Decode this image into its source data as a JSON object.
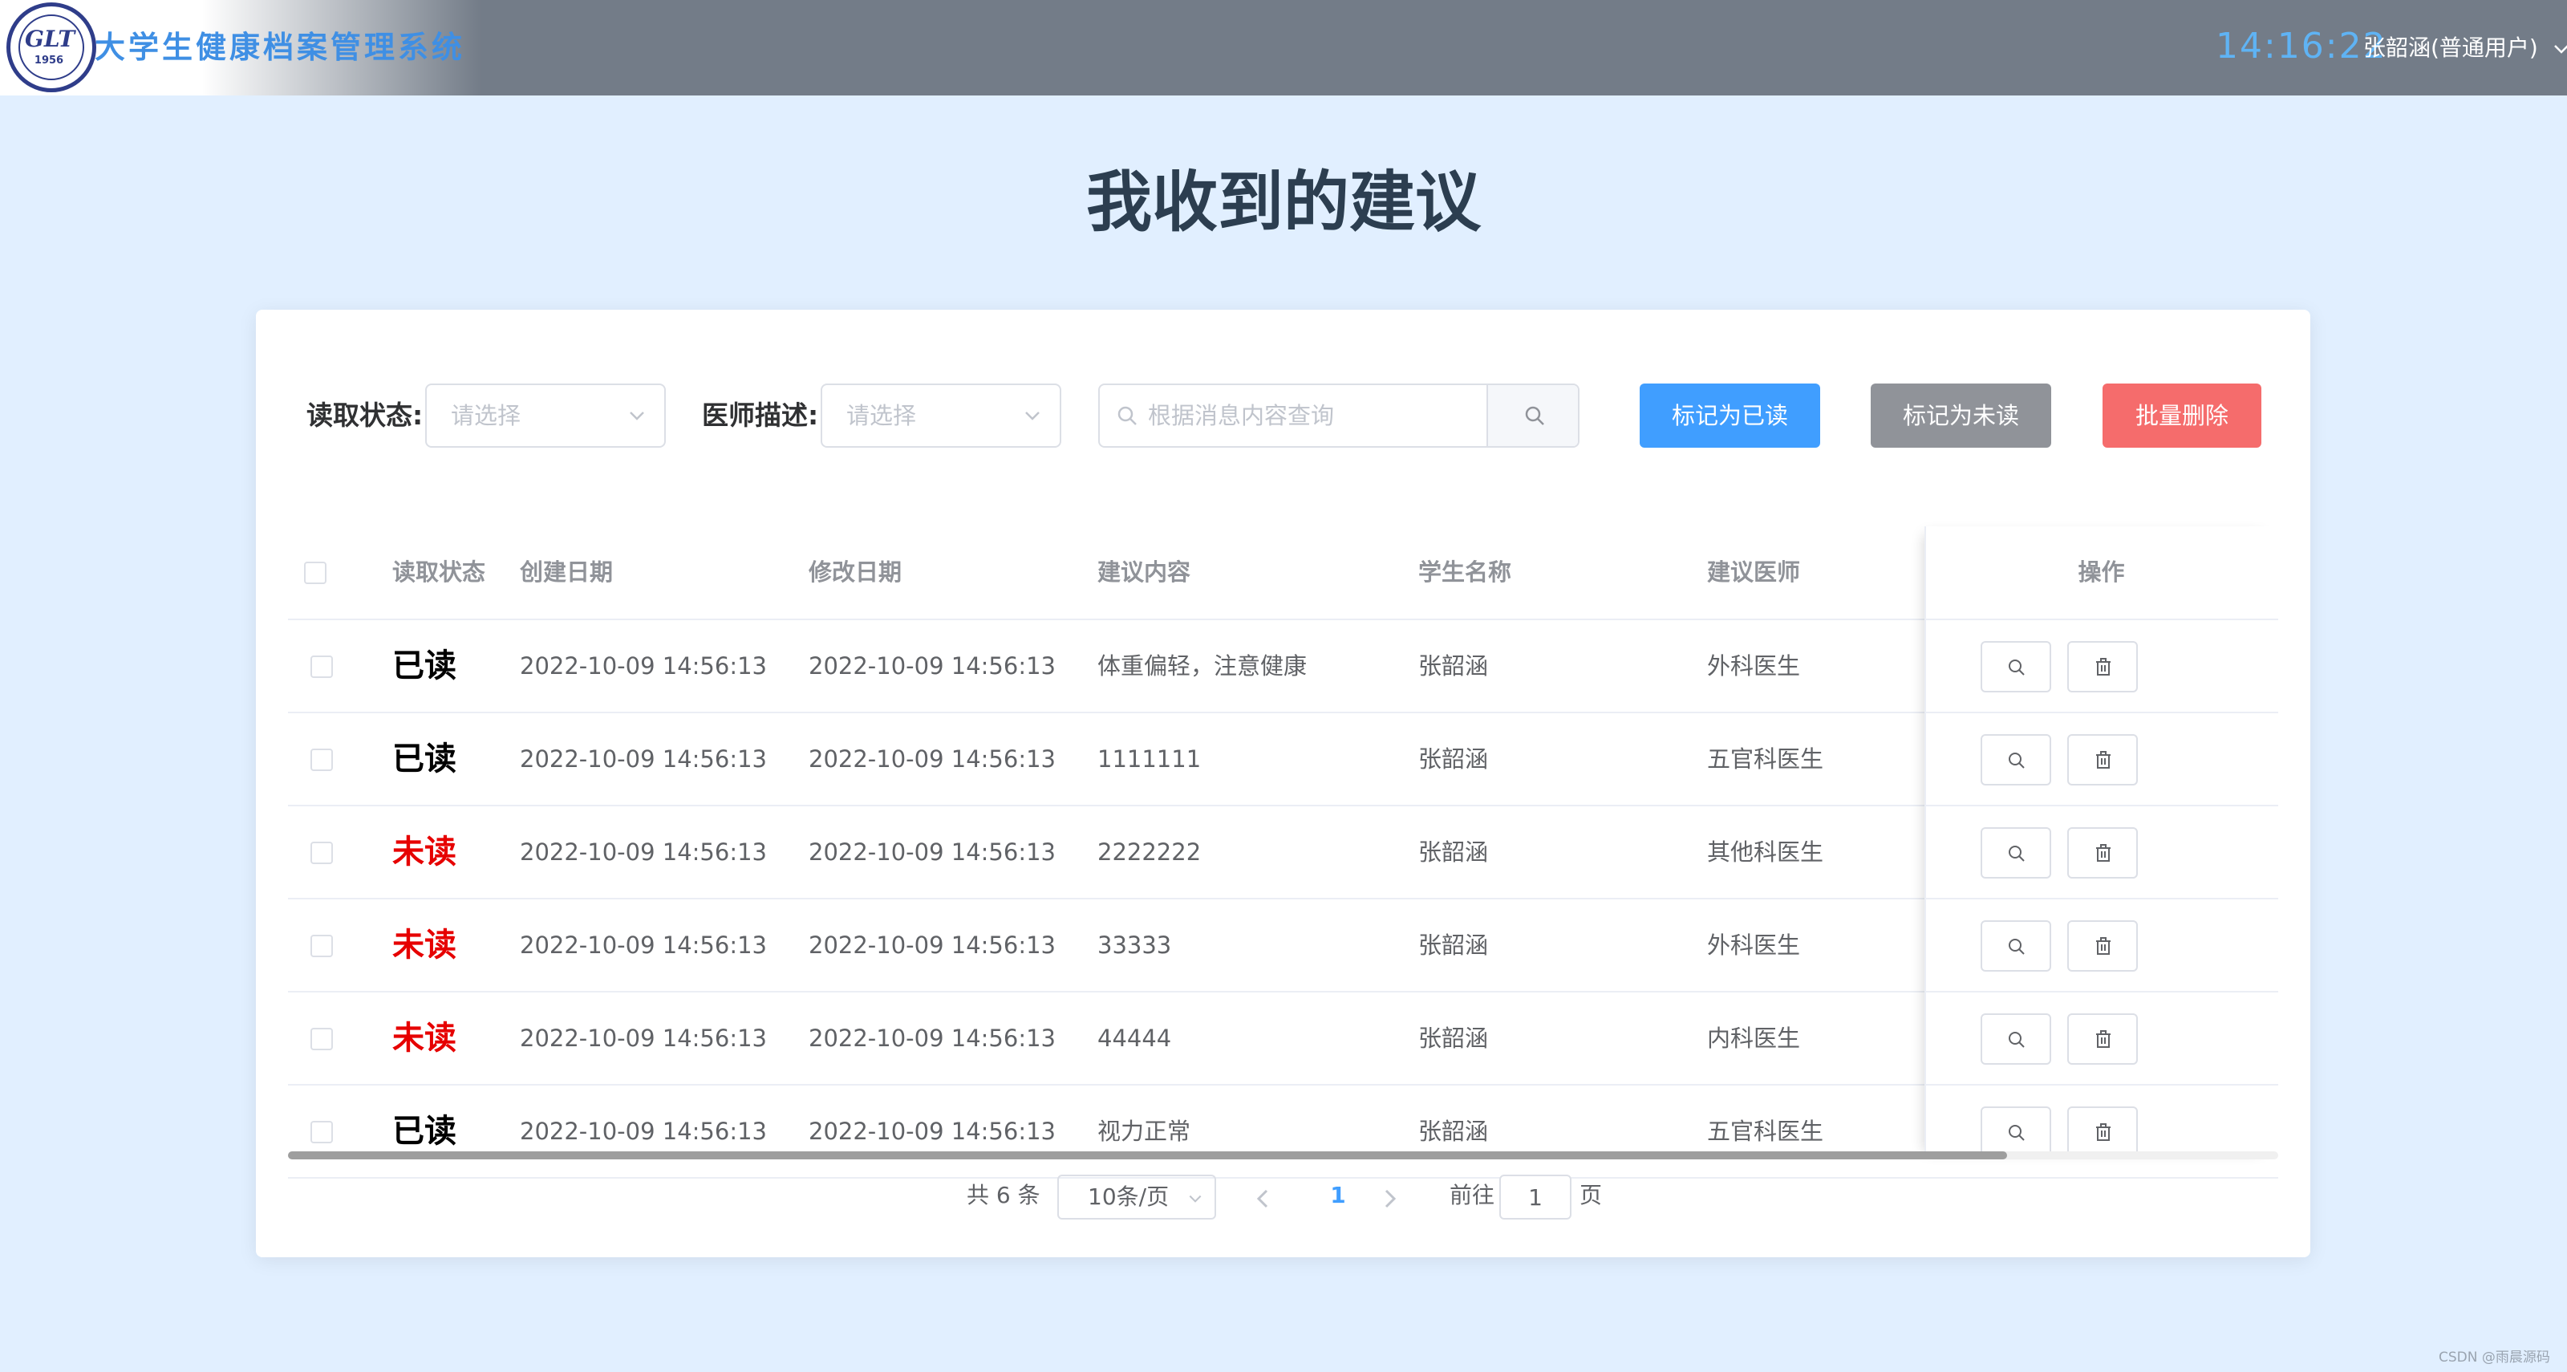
{
  "header": {
    "logo_year": "1956",
    "system_title": "大学生健康档案管理系统",
    "clock": "14:16:22",
    "user_label": "张韶涵(普通用户)"
  },
  "page_title": "我收到的建议",
  "filters": {
    "read_status_label": "读取状态:",
    "read_status_placeholder": "请选择",
    "doctor_desc_label": "医师描述:",
    "doctor_desc_placeholder": "请选择",
    "search_placeholder": "根据消息内容查询"
  },
  "actions": {
    "mark_read": "标记为已读",
    "mark_unread": "标记为未读",
    "batch_delete": "批量删除"
  },
  "colors": {
    "read": "#000000",
    "unread": "#e60000"
  },
  "table": {
    "columns": [
      "读取状态",
      "创建日期",
      "修改日期",
      "建议内容",
      "学生名称",
      "建议医师",
      "操作"
    ],
    "rows": [
      {
        "status": "已读",
        "unread": false,
        "created": "2022-10-09 14:56:13",
        "modified": "2022-10-09 14:56:13",
        "content": "体重偏轻，注意健康",
        "student": "张韶涵",
        "doctor": "外科医生"
      },
      {
        "status": "已读",
        "unread": false,
        "created": "2022-10-09 14:56:13",
        "modified": "2022-10-09 14:56:13",
        "content": "1111111",
        "student": "张韶涵",
        "doctor": "五官科医生"
      },
      {
        "status": "未读",
        "unread": true,
        "created": "2022-10-09 14:56:13",
        "modified": "2022-10-09 14:56:13",
        "content": "2222222",
        "student": "张韶涵",
        "doctor": "其他科医生"
      },
      {
        "status": "未读",
        "unread": true,
        "created": "2022-10-09 14:56:13",
        "modified": "2022-10-09 14:56:13",
        "content": "33333",
        "student": "张韶涵",
        "doctor": "外科医生"
      },
      {
        "status": "未读",
        "unread": true,
        "created": "2022-10-09 14:56:13",
        "modified": "2022-10-09 14:56:13",
        "content": "44444",
        "student": "张韶涵",
        "doctor": "内科医生"
      },
      {
        "status": "已读",
        "unread": false,
        "created": "2022-10-09 14:56:13",
        "modified": "2022-10-09 14:56:13",
        "content": "视力正常",
        "student": "张韶涵",
        "doctor": "五官科医生"
      }
    ]
  },
  "pagination": {
    "total": "共 6 条",
    "page_size": "10条/页",
    "current_page": "1",
    "goto_prefix": "前往",
    "goto_value": "1",
    "goto_suffix": "页"
  },
  "watermark": "CSDN @雨晨源码"
}
